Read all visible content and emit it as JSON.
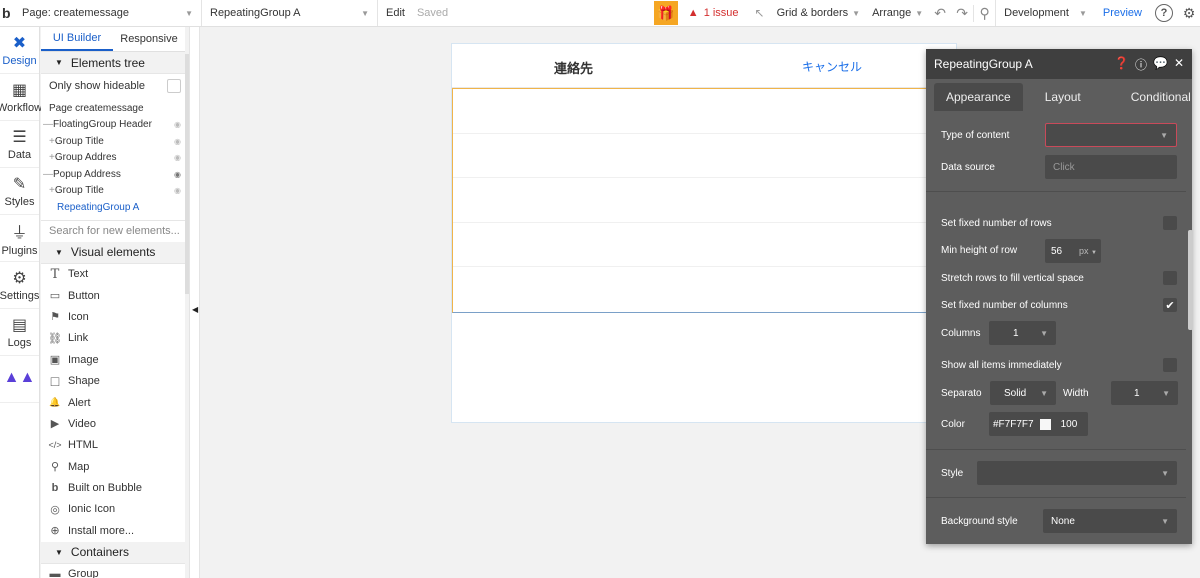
{
  "topbar": {
    "logo": "b",
    "page_select": "Page: createmessage",
    "element_select": "RepeatingGroup A",
    "edit": "Edit",
    "saved": "Saved",
    "issue": "1 issue",
    "grid": "Grid & borders",
    "arrange": "Arrange",
    "environment": "Development",
    "preview": "Preview",
    "help": "?"
  },
  "iconbar": {
    "items": [
      {
        "label": "Design",
        "icon": "design-icon"
      },
      {
        "label": "Workflow",
        "icon": "workflow-icon"
      },
      {
        "label": "Data",
        "icon": "database-icon"
      },
      {
        "label": "Styles",
        "icon": "brush-icon"
      },
      {
        "label": "Plugins",
        "icon": "plug-icon"
      },
      {
        "label": "Settings",
        "icon": "gear-icon"
      },
      {
        "label": "Logs",
        "icon": "document-icon"
      }
    ]
  },
  "leftpanel": {
    "tabs": [
      "UI Builder",
      "Responsive"
    ],
    "tree_header": "Elements tree",
    "only_show_hideable": "Only show hideable",
    "tree": [
      {
        "label": "Page createmessage",
        "prefix": "",
        "eye": ""
      },
      {
        "label": "FloatingGroup Header",
        "prefix": "—",
        "eye": "◉"
      },
      {
        "label": "Group Title",
        "prefix": "+",
        "eye": "◉"
      },
      {
        "label": "Group Addres",
        "prefix": "+",
        "eye": "◉"
      },
      {
        "label": "Popup Address",
        "prefix": "—",
        "eye": "◉"
      },
      {
        "label": "Group Title",
        "prefix": "+",
        "eye": "◉"
      },
      {
        "label": "RepeatingGroup A",
        "prefix": "",
        "eye": ""
      }
    ],
    "search_placeholder": "Search for new elements...",
    "visual_header": "Visual elements",
    "visual_elements": [
      {
        "label": "Text",
        "icon": "T"
      },
      {
        "label": "Button",
        "icon": "▭"
      },
      {
        "label": "Icon",
        "icon": "⚑"
      },
      {
        "label": "Link",
        "icon": "⛓"
      },
      {
        "label": "Image",
        "icon": "▣"
      },
      {
        "label": "Shape",
        "icon": "□"
      },
      {
        "label": "Alert",
        "icon": "🔔"
      },
      {
        "label": "Video",
        "icon": "▶"
      },
      {
        "label": "HTML",
        "icon": "</>"
      },
      {
        "label": "Map",
        "icon": "⚲"
      },
      {
        "label": "Built on Bubble",
        "icon": "b"
      },
      {
        "label": "Ionic Icon",
        "icon": "◎"
      },
      {
        "label": "Install more...",
        "icon": "⊕"
      }
    ],
    "containers_header": "Containers",
    "containers": [
      {
        "label": "Group",
        "icon": "▬"
      }
    ]
  },
  "canvas": {
    "title": "連絡先",
    "cancel": "キャンセル"
  },
  "props": {
    "title": "RepeatingGroup A",
    "tabs": [
      "Appearance",
      "Layout",
      "Conditional"
    ],
    "type_of_content": "Type of content",
    "data_source": "Data source",
    "data_source_placeholder": "Click",
    "fixed_rows": "Set fixed number of rows",
    "min_height": "Min height of row",
    "min_height_value": "56",
    "unit": "px",
    "stretch_rows": "Stretch rows to fill vertical space",
    "fixed_columns": "Set fixed number of columns",
    "columns": "Columns",
    "columns_value": "1",
    "show_all": "Show all items immediately",
    "separator": "Separato",
    "separator_value": "Solid",
    "width": "Width",
    "width_value": "1",
    "color": "Color",
    "color_hex": "#F7F7F7",
    "opacity": "100",
    "style": "Style",
    "background_style": "Background style",
    "background_value": "None"
  }
}
